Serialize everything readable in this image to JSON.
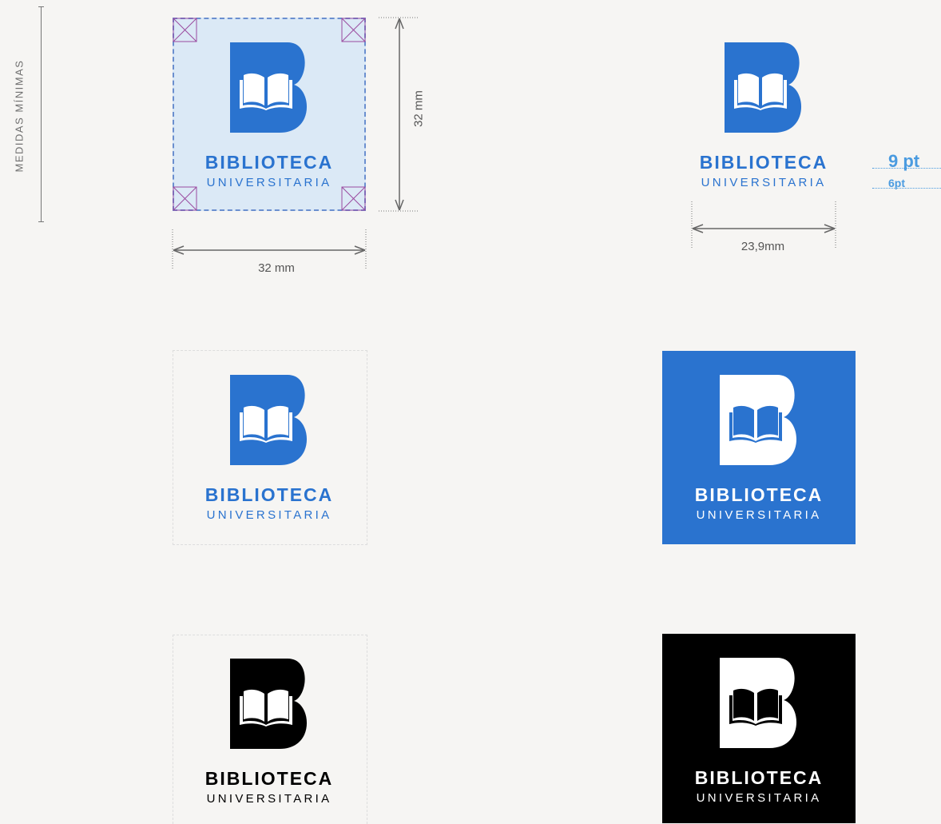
{
  "side_label": "MEDIDAS MÍNIMAS",
  "brand": {
    "title": "BIBLIOTECA",
    "subtitle": "UNIVERSITARIA",
    "blue": "#2a73cf",
    "black": "#000000",
    "white": "#ffffff",
    "safe_zone_fill": "#dbe9f6"
  },
  "minimum_size": {
    "height_label": "32 mm",
    "width_label": "32 mm",
    "text_width_label": "23,9mm",
    "title_size_label": "9 pt",
    "subtitle_size_label": "6pt"
  },
  "variants": [
    {
      "name": "blue-on-light",
      "letter_color": "#2a73cf",
      "background": "transparent"
    },
    {
      "name": "white-on-blue",
      "letter_color": "#ffffff",
      "background": "#2a73cf"
    },
    {
      "name": "black-on-light",
      "letter_color": "#000000",
      "background": "transparent"
    },
    {
      "name": "white-on-black",
      "letter_color": "#ffffff",
      "background": "#000000"
    }
  ],
  "icons": [
    "b-letter-icon",
    "open-book-icon",
    "dimension-arrow-icon",
    "corner-cross-icon"
  ]
}
